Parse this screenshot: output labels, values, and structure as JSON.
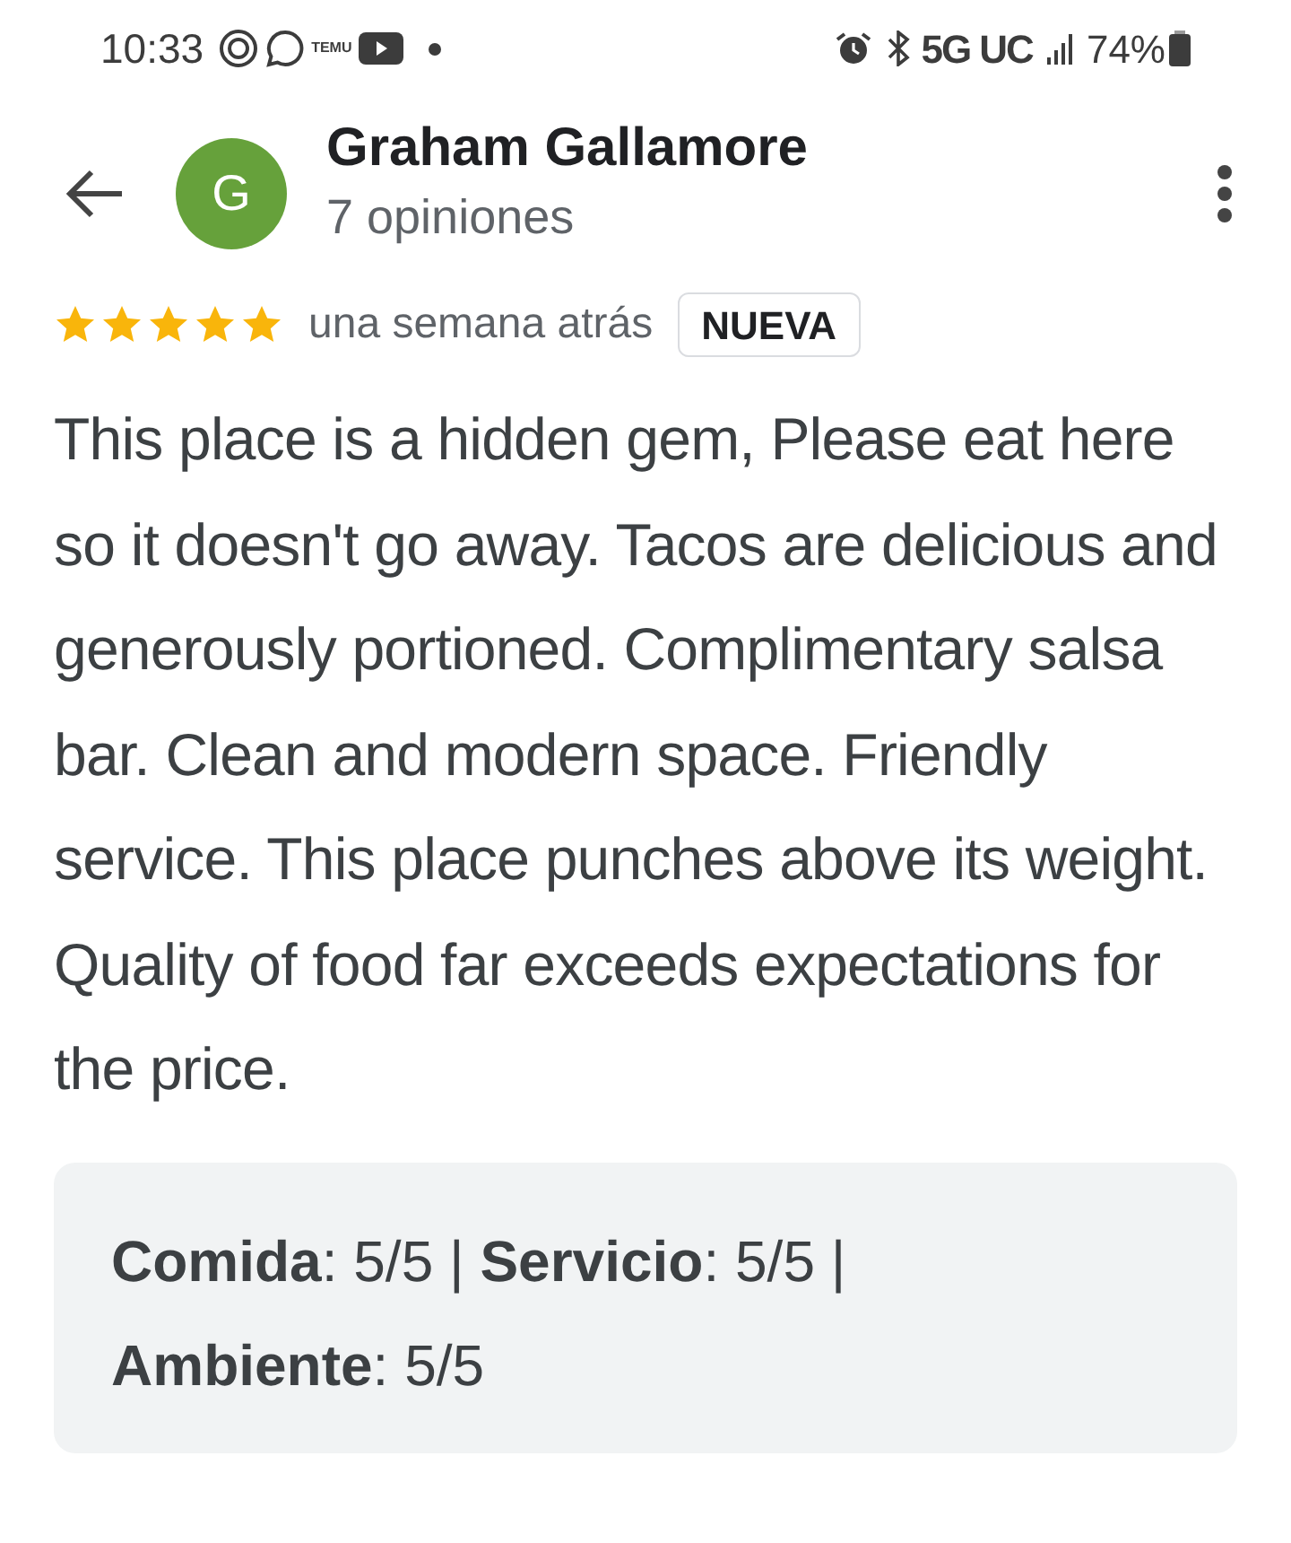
{
  "status_bar": {
    "time": "10:33",
    "temu_label": "TEMU",
    "network": "5G UC",
    "battery": "74%"
  },
  "header": {
    "avatar_letter": "G",
    "name": "Graham Gallamore",
    "subtitle": "7 opiniones"
  },
  "review": {
    "stars": 5,
    "date": "una semana atrás",
    "badge": "NUEVA",
    "text": "This place is a hidden gem, Please eat here so it doesn't go away. Tacos are delicious and generously portioned. Complimentary salsa bar. Clean and modern space. Friendly service. This place punches above its weight. Quality of food far exceeds expectations for the price.",
    "ratings": "**Comida**: 5/5 | **Servicio**: 5/5 | **Ambiente**: 5/5"
  }
}
